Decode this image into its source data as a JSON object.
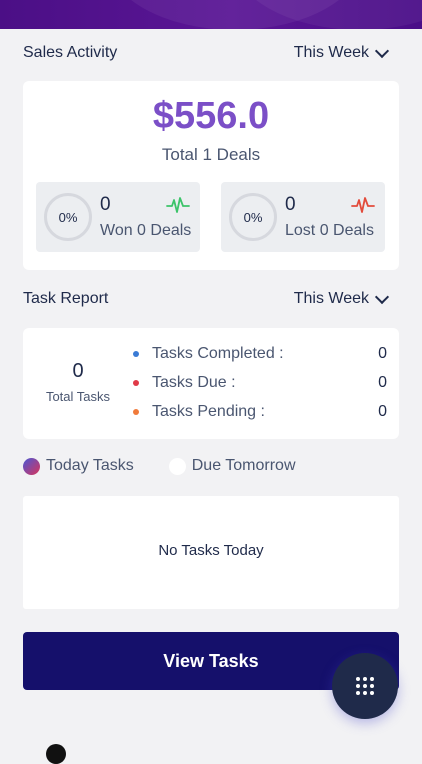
{
  "sales": {
    "title": "Sales Activity",
    "period": "This Week",
    "amount": "$556.0",
    "total_deals": "Total 1 Deals",
    "won": {
      "percent": "0%",
      "count": "0",
      "label": "Won 0 Deals",
      "color": "#3cc46a"
    },
    "lost": {
      "percent": "0%",
      "count": "0",
      "label": "Lost 0 Deals",
      "color": "#e24b3b"
    }
  },
  "tasks": {
    "title": "Task Report",
    "period": "This Week",
    "total_count": "0",
    "total_label": "Total Tasks",
    "legend": [
      {
        "label": "Tasks Completed :",
        "value": "0",
        "color": "#3a7bd5"
      },
      {
        "label": "Tasks Due :",
        "value": "0",
        "color": "#e03a48"
      },
      {
        "label": "Tasks Pending :",
        "value": "0",
        "color": "#f07a3a"
      }
    ]
  },
  "tabs": {
    "today": "Today Tasks",
    "tomorrow": "Due Tomorrow"
  },
  "today_panel": {
    "empty_text": "No Tasks Today"
  },
  "actions": {
    "view_tasks": "View Tasks"
  },
  "colors": {
    "accent": "#7b4fc7",
    "primary_button": "#15106b",
    "header": "#4b0f86"
  },
  "icons": {
    "fab": "grid-dots-icon",
    "dropdown": "chevron-down-icon",
    "won": "pulse-icon",
    "lost": "pulse-icon"
  }
}
